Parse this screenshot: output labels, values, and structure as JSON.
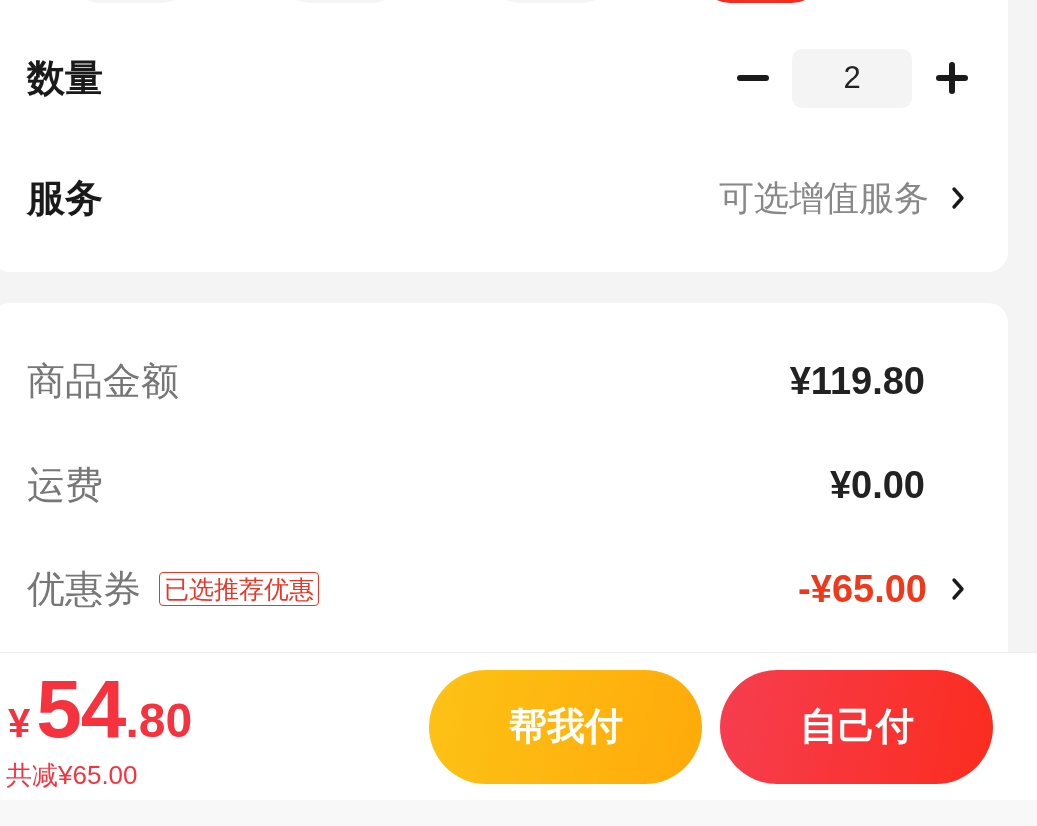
{
  "spec_options": [
    {
      "selected": false
    },
    {
      "selected": false
    },
    {
      "selected": false
    },
    {
      "selected": true
    }
  ],
  "quantity": {
    "label": "数量",
    "value": "2"
  },
  "service": {
    "label": "服务",
    "value": "可选增值服务"
  },
  "summary": [
    {
      "kind": "amount",
      "label": "商品金额",
      "value": "¥119.80"
    },
    {
      "kind": "amount",
      "label": "运费",
      "value": "¥0.00"
    },
    {
      "kind": "coupon",
      "label": "优惠券",
      "badge": "已选推荐优惠",
      "value": "-¥65.00"
    }
  ],
  "footer": {
    "price": {
      "currency": "¥",
      "integer": "54",
      "decimal": ".80"
    },
    "savings": "共减¥65.00",
    "buttons": [
      {
        "kind": "secondary",
        "label": "帮我付"
      },
      {
        "kind": "primary",
        "label": "自己付"
      }
    ]
  }
}
